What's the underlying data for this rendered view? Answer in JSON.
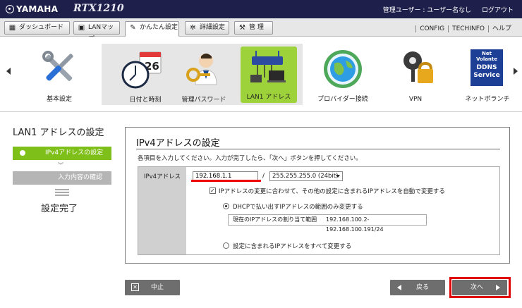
{
  "header": {
    "brand": "YAMAHA",
    "model": "RTX1210",
    "user_label": "管理ユーザー : ユーザー名なし",
    "logout": "ログアウト"
  },
  "tabs": [
    {
      "label": "ダッシュボード",
      "icon": "dashboard-icon"
    },
    {
      "label": "LANマップ",
      "icon": "network-map-icon"
    },
    {
      "label": "かんたん設定",
      "icon": "wand-icon",
      "active": true
    },
    {
      "label": "詳細設定",
      "icon": "gear-icon"
    },
    {
      "label": "管 理",
      "icon": "wrench-icon"
    }
  ],
  "right_links": [
    "CONFIG",
    "TECHINFO",
    "ヘルプ"
  ],
  "icons": [
    {
      "label": "基本設定",
      "icon": "tools-icon"
    },
    {
      "label": "日付と時刻",
      "icon": "clock-calendar-icon",
      "calendar_day": "26"
    },
    {
      "label": "管理パスワード",
      "icon": "admin-key-icon"
    },
    {
      "label": "LAN1 アドレス",
      "icon": "lan-router-icon",
      "selected": true
    },
    {
      "label": "プロバイダー接続",
      "icon": "globe-icon"
    },
    {
      "label": "VPN",
      "icon": "lock-key-icon"
    },
    {
      "label": "ネットボランチ",
      "icon": "ddns-icon",
      "badge": [
        "Net",
        "Volante",
        "DDNS",
        "Service"
      ]
    }
  ],
  "steps": {
    "title": "LAN1 アドレスの設定",
    "current": "IPv4アドレスの設定",
    "next": "入力内容の確認",
    "done": "設定完了"
  },
  "panel": {
    "title": "IPv4アドレスの設定",
    "instruction": "各項目を入力してください。入力が完了したら、「次へ」ボタンを押してください。",
    "field_label": "IPv4アドレス",
    "ip_value": "192.168.1.1",
    "separator": "/",
    "mask_value": "255.255.255.0 (24bit)",
    "checkbox_label": "IPアドレスの変更に合わせて、その他の設定に含まれるIPアドレスを自動で変更する",
    "checkbox_mark": "✓",
    "radio1_label": "DHCPで払い出すIPアドレスの範囲のみ変更する",
    "range_key": "現在のIPアドレスの割り当て範囲",
    "range_value": "192.168.100.2-192.168.100.191/24",
    "radio2_label": "設定に含まれるIPアドレスをすべて変更する"
  },
  "buttons": {
    "cancel": "中止",
    "back": "戻る",
    "next": "次へ"
  },
  "colors": {
    "header_bg": "#1f1f4b",
    "accent_green": "#7fbf1a",
    "highlight_red": "#e00000"
  }
}
